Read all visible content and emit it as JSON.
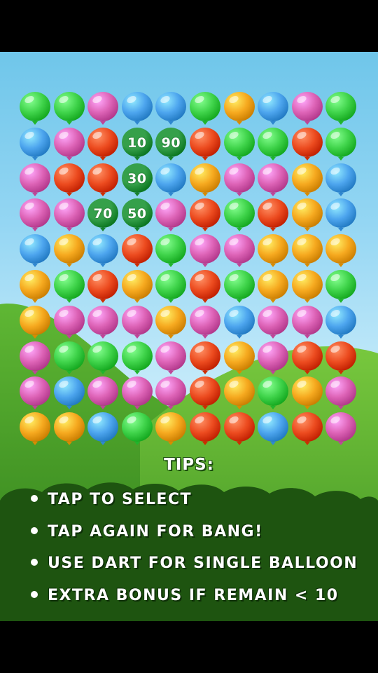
{
  "colors": {
    "green": "#3fd34a",
    "pink": "#dd63b6",
    "blue": "#4da5ee",
    "orange": "#f6a91f",
    "red": "#ec4b1f",
    "selected": "#35a04a"
  },
  "board": {
    "columns": 10,
    "rows": [
      [
        "green",
        "green",
        "pink",
        "blue",
        "blue",
        "green",
        "orange",
        "blue",
        "pink",
        "green"
      ],
      [
        "blue",
        "pink",
        "red",
        "selected",
        "selected",
        "red",
        "green",
        "green",
        "red",
        "green"
      ],
      [
        "pink",
        "red",
        "red",
        "selected",
        "blue",
        "orange",
        "pink",
        "pink",
        "orange",
        "blue"
      ],
      [
        "pink",
        "pink",
        "selected",
        "selected",
        "pink",
        "red",
        "green",
        "red",
        "orange",
        "blue"
      ],
      [
        "blue",
        "orange",
        "blue",
        "red",
        "green",
        "pink",
        "pink",
        "orange",
        "orange",
        "orange"
      ],
      [
        "orange",
        "green",
        "red",
        "orange",
        "green",
        "red",
        "green",
        "orange",
        "orange",
        "green"
      ],
      [
        "orange",
        "pink",
        "pink",
        "pink",
        "orange",
        "pink",
        "blue",
        "pink",
        "pink",
        "blue"
      ],
      [
        "pink",
        "green",
        "green",
        "green",
        "pink",
        "red",
        "orange",
        "pink",
        "red",
        "red"
      ],
      [
        "pink",
        "blue",
        "pink",
        "pink",
        "pink",
        "red",
        "orange",
        "green",
        "orange",
        "pink"
      ],
      [
        "orange",
        "orange",
        "blue",
        "green",
        "orange",
        "red",
        "red",
        "blue",
        "red",
        "pink"
      ]
    ],
    "selected_values": [
      {
        "row": 1,
        "col": 3,
        "value": "10"
      },
      {
        "row": 1,
        "col": 4,
        "value": "90"
      },
      {
        "row": 2,
        "col": 3,
        "value": "30"
      },
      {
        "row": 3,
        "col": 2,
        "value": "70"
      },
      {
        "row": 3,
        "col": 3,
        "value": "50"
      }
    ]
  },
  "tips": {
    "title": "TIPS:",
    "items": [
      "TAP TO SELECT",
      "TAP AGAIN FOR BANG!",
      "USE DART FOR SINGLE BALLOON",
      "EXTRA BONUS IF REMAIN < 10"
    ]
  }
}
